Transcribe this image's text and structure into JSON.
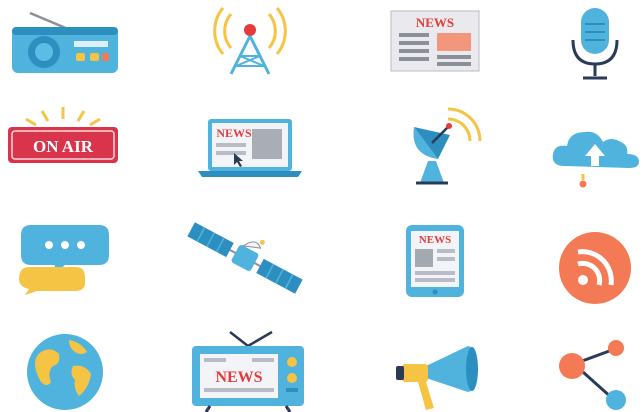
{
  "icons": [
    {
      "name": "radio-icon"
    },
    {
      "name": "broadcast-tower-icon"
    },
    {
      "name": "newspaper-icon",
      "label": "NEWS"
    },
    {
      "name": "microphone-icon"
    },
    {
      "name": "on-air-sign-icon",
      "label": "ON AIR"
    },
    {
      "name": "laptop-news-icon",
      "label": "NEWS"
    },
    {
      "name": "satellite-dish-icon"
    },
    {
      "name": "cloud-upload-icon"
    },
    {
      "name": "chat-bubbles-icon"
    },
    {
      "name": "satellite-icon"
    },
    {
      "name": "tablet-news-icon",
      "label": "NEWS"
    },
    {
      "name": "rss-feed-icon"
    },
    {
      "name": "globe-icon"
    },
    {
      "name": "tv-news-icon",
      "label": "NEWS"
    },
    {
      "name": "megaphone-icon"
    },
    {
      "name": "share-icon"
    }
  ],
  "colors": {
    "blue": "#4fb3de",
    "dark_blue": "#2d8fbf",
    "orange": "#f47a55",
    "yellow": "#f6c445",
    "red": "#e53b3b",
    "gray": "#8a8f99",
    "navy": "#2b3a55"
  }
}
